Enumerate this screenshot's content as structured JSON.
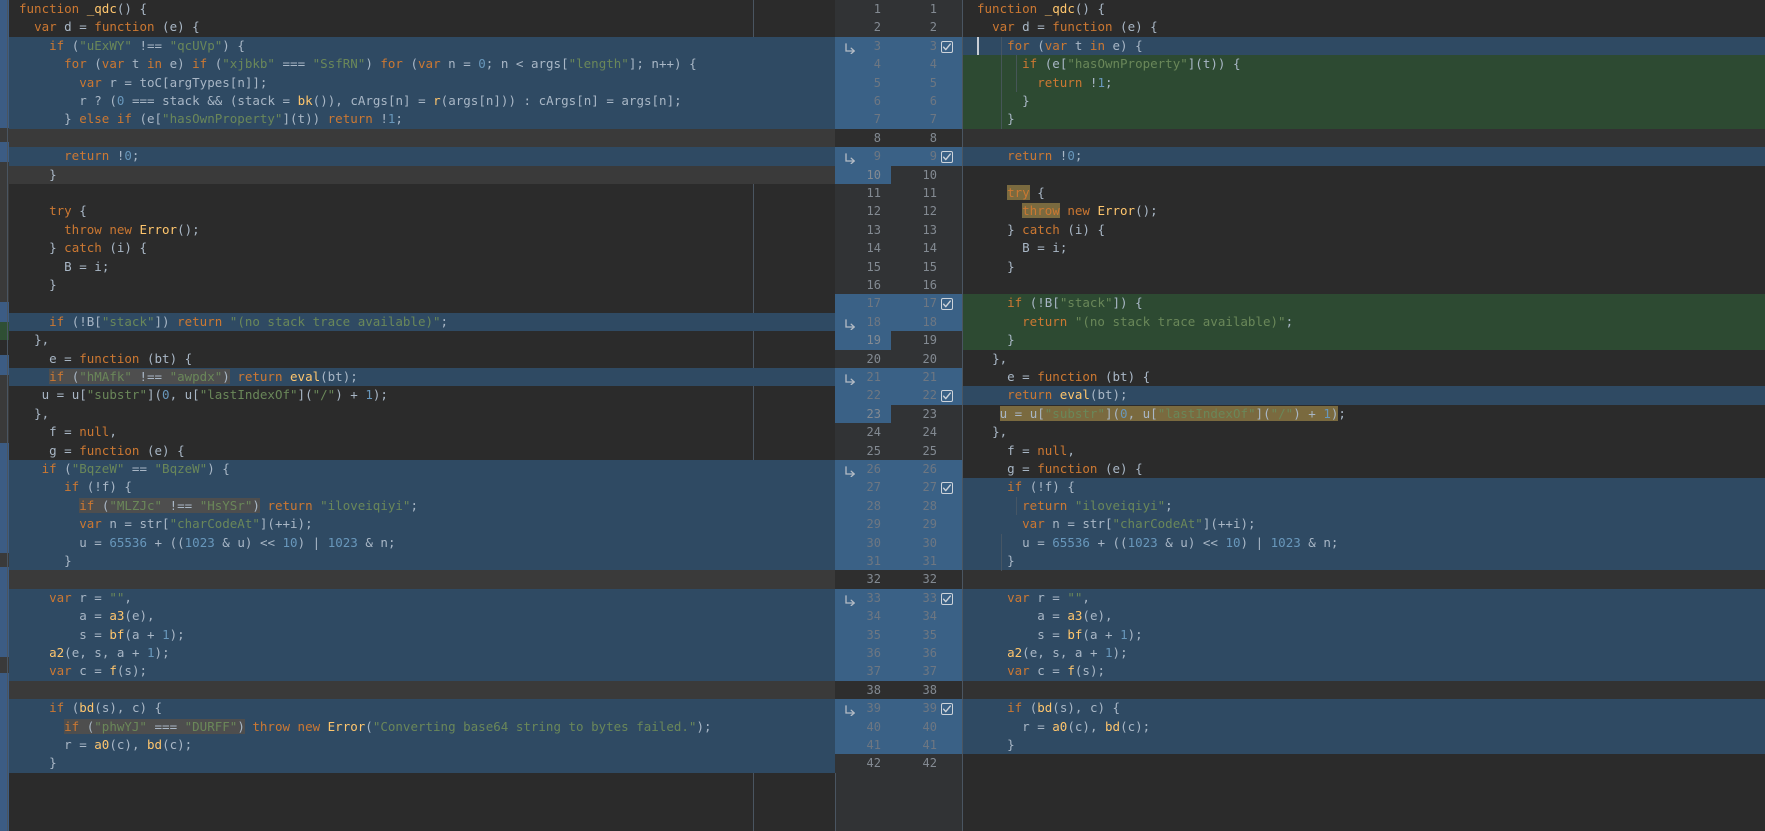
{
  "app": {
    "type": "ide-diff-viewer",
    "theme": "darcula",
    "colors": {
      "background": "#2b2b2b",
      "gutter": "#313335",
      "modified_row": "#2f4a63",
      "added_row": "#2d4a32",
      "unchanged_gap": "#3a3a3a",
      "gutter_selected": "#3a6186",
      "inline_match_highlight": "#7a6a3f",
      "keyword": "#cc7832",
      "string": "#6a8759",
      "number": "#6897bb",
      "function": "#ffc66d",
      "identifier": "#a9b7c6",
      "class": "#b9a0d8",
      "separator": "#4a5561"
    }
  },
  "left_pane": {
    "name": "original-version",
    "lines": [
      {
        "bg": "none",
        "text": "function _qdc() {"
      },
      {
        "bg": "none",
        "text": "  var d = function (e) {"
      },
      {
        "bg": "blue",
        "text": "    if (\"uExWY\" !== \"qcUVp\") {"
      },
      {
        "bg": "blue",
        "text": "      for (var t in e) if (\"xjbkb\" === \"SsfRN\") for (var n = 0; n < args[\"length\"]; n++) {"
      },
      {
        "bg": "blue",
        "text": "        var r = toC[argTypes[n]];"
      },
      {
        "bg": "blue",
        "text": "        r ? (0 === stack && (stack = bk()), cArgs[n] = r(args[n])) : cArgs[n] = args[n];"
      },
      {
        "bg": "blue",
        "text": "      } else if (e[\"hasOwnProperty\"](t)) return !1;"
      },
      {
        "bg": "gray",
        "text": ""
      },
      {
        "bg": "blue",
        "text": "      return !0;"
      },
      {
        "bg": "gray",
        "text": "    }"
      },
      {
        "bg": "none",
        "text": ""
      },
      {
        "bg": "none",
        "text": "    try {"
      },
      {
        "bg": "none",
        "text": "      throw new Error();"
      },
      {
        "bg": "none",
        "text": "    } catch (i) {"
      },
      {
        "bg": "none",
        "text": "      B = i;"
      },
      {
        "bg": "none",
        "text": "    }"
      },
      {
        "bg": "none",
        "text": ""
      },
      {
        "bg": "blue",
        "text": "    if (!B[\"stack\"]) return \"(no stack trace available)\";"
      },
      {
        "bg": "none",
        "text": "  },"
      },
      {
        "bg": "none",
        "text": "    e = function (bt) {"
      },
      {
        "bg": "blue",
        "text": "    if (\"hMAfk\" !== \"awpdx\") return eval(bt);"
      },
      {
        "bg": "none",
        "text": "   u = u[\"substr\"](0, u[\"lastIndexOf\"](\"/\") + 1);"
      },
      {
        "bg": "none",
        "text": "  },"
      },
      {
        "bg": "none",
        "text": "    f = null,"
      },
      {
        "bg": "none",
        "text": "    g = function (e) {"
      },
      {
        "bg": "blue",
        "text": "   if (\"BqzeW\" == \"BqzeW\") {"
      },
      {
        "bg": "blue",
        "text": "      if (!f) {"
      },
      {
        "bg": "blue",
        "text": "        if (\"MLZJc\" !== \"HsYSr\") return \"iloveiqiyi\";"
      },
      {
        "bg": "blue",
        "text": "        var n = str[\"charCodeAt\"](++i);"
      },
      {
        "bg": "blue",
        "text": "        u = 65536 + ((1023 & u) << 10) | 1023 & n;"
      },
      {
        "bg": "blue",
        "text": "      }"
      },
      {
        "bg": "gray",
        "text": ""
      },
      {
        "bg": "blue",
        "text": "    var r = \"\","
      },
      {
        "bg": "blue",
        "text": "        a = a3(e),"
      },
      {
        "bg": "blue",
        "text": "        s = bf(a + 1);"
      },
      {
        "bg": "blue",
        "text": "    a2(e, s, a + 1);"
      },
      {
        "bg": "blue",
        "text": "    var c = f(s);"
      },
      {
        "bg": "gray",
        "text": ""
      },
      {
        "bg": "blue",
        "text": "    if (bd(s), c) {"
      },
      {
        "bg": "blue",
        "text": "      if (\"phwYJ\" === \"DURFF\") throw new Error(\"Converting base64 string to bytes failed.\");"
      },
      {
        "bg": "blue",
        "text": "      r = a0(c), bd(c);"
      },
      {
        "bg": "blue",
        "text": "    }"
      }
    ]
  },
  "gutter": {
    "name": "diff-gutter",
    "rows": [
      {
        "left": "1",
        "right": "1",
        "bg": "dark",
        "check": false,
        "arrow": false
      },
      {
        "left": "2",
        "right": "2",
        "bg": "dark",
        "check": false,
        "arrow": false
      },
      {
        "left": "3",
        "right": "3",
        "bg": "blue",
        "check": true,
        "arrow": true
      },
      {
        "left": "4",
        "right": "4",
        "bg": "blue",
        "check": false,
        "arrow": false
      },
      {
        "left": "5",
        "right": "5",
        "bg": "blue",
        "check": false,
        "arrow": false
      },
      {
        "left": "6",
        "right": "6",
        "bg": "blue",
        "check": false,
        "arrow": false
      },
      {
        "left": "7",
        "right": "7",
        "bg": "blue",
        "check": false,
        "arrow": false
      },
      {
        "left": "8",
        "right": "8",
        "bg": "darker",
        "check": false,
        "arrow": false
      },
      {
        "left": "9",
        "right": "9",
        "bg": "blue",
        "check": true,
        "arrow": true
      },
      {
        "left": "10",
        "right": "10",
        "bg": "split",
        "check": false,
        "arrow": false
      },
      {
        "left": "11",
        "right": "11",
        "bg": "dark",
        "check": false,
        "arrow": false
      },
      {
        "left": "12",
        "right": "12",
        "bg": "dark",
        "check": false,
        "arrow": false
      },
      {
        "left": "13",
        "right": "13",
        "bg": "dark",
        "check": false,
        "arrow": false
      },
      {
        "left": "14",
        "right": "14",
        "bg": "dark",
        "check": false,
        "arrow": false
      },
      {
        "left": "15",
        "right": "15",
        "bg": "dark",
        "check": false,
        "arrow": false
      },
      {
        "left": "16",
        "right": "16",
        "bg": "dark",
        "check": false,
        "arrow": false
      },
      {
        "left": "17",
        "right": "17",
        "bg": "blue",
        "check": true,
        "arrow": false
      },
      {
        "left": "18",
        "right": "18",
        "bg": "blue",
        "check": false,
        "arrow": true
      },
      {
        "left": "19",
        "right": "19",
        "bg": "split",
        "check": false,
        "arrow": false
      },
      {
        "left": "20",
        "right": "20",
        "bg": "dark",
        "check": false,
        "arrow": false
      },
      {
        "left": "21",
        "right": "21",
        "bg": "blue",
        "check": false,
        "arrow": true
      },
      {
        "left": "22",
        "right": "22",
        "bg": "blue",
        "check": true,
        "arrow": false
      },
      {
        "left": "23",
        "right": "23",
        "bg": "split",
        "check": false,
        "arrow": false
      },
      {
        "left": "24",
        "right": "24",
        "bg": "dark",
        "check": false,
        "arrow": false
      },
      {
        "left": "25",
        "right": "25",
        "bg": "dark",
        "check": false,
        "arrow": false
      },
      {
        "left": "26",
        "right": "26",
        "bg": "blue",
        "check": false,
        "arrow": true
      },
      {
        "left": "27",
        "right": "27",
        "bg": "blue",
        "check": true,
        "arrow": false
      },
      {
        "left": "28",
        "right": "28",
        "bg": "blue",
        "check": false,
        "arrow": false
      },
      {
        "left": "29",
        "right": "29",
        "bg": "blue",
        "check": false,
        "arrow": false
      },
      {
        "left": "30",
        "right": "30",
        "bg": "blue",
        "check": false,
        "arrow": false
      },
      {
        "left": "31",
        "right": "31",
        "bg": "blue",
        "check": false,
        "arrow": false
      },
      {
        "left": "32",
        "right": "32",
        "bg": "darker",
        "check": false,
        "arrow": false
      },
      {
        "left": "33",
        "right": "33",
        "bg": "blue",
        "check": true,
        "arrow": true
      },
      {
        "left": "34",
        "right": "34",
        "bg": "blue",
        "check": false,
        "arrow": false
      },
      {
        "left": "35",
        "right": "35",
        "bg": "blue",
        "check": false,
        "arrow": false
      },
      {
        "left": "36",
        "right": "36",
        "bg": "blue",
        "check": false,
        "arrow": false
      },
      {
        "left": "37",
        "right": "37",
        "bg": "blue",
        "check": false,
        "arrow": false
      },
      {
        "left": "38",
        "right": "38",
        "bg": "darker",
        "check": false,
        "arrow": false
      },
      {
        "left": "39",
        "right": "39",
        "bg": "blue",
        "check": true,
        "arrow": true
      },
      {
        "left": "40",
        "right": "40",
        "bg": "blue",
        "check": false,
        "arrow": false
      },
      {
        "left": "41",
        "right": "41",
        "bg": "blue",
        "check": false,
        "arrow": false
      },
      {
        "left": "42",
        "right": "42",
        "bg": "dark",
        "check": false,
        "arrow": false
      }
    ],
    "checkbox_glyph": "☑",
    "arrow_glyph": "⌐"
  },
  "right_pane": {
    "name": "modified-version",
    "lines": [
      {
        "bg": "none",
        "text": "function _qdc() {"
      },
      {
        "bg": "none",
        "text": "  var d = function (e) {"
      },
      {
        "bg": "blue",
        "text": "    for (var t in e) {"
      },
      {
        "bg": "green",
        "text": "      if (e[\"hasOwnProperty\"](t)) {"
      },
      {
        "bg": "green",
        "text": "        return !1;"
      },
      {
        "bg": "green",
        "text": "      }"
      },
      {
        "bg": "green",
        "text": "    }"
      },
      {
        "bg": "dark",
        "text": ""
      },
      {
        "bg": "blue",
        "text": "    return !0;"
      },
      {
        "bg": "none",
        "text": ""
      },
      {
        "bg": "none",
        "text": "    try {"
      },
      {
        "bg": "none",
        "text": "      throw new Error();"
      },
      {
        "bg": "none",
        "text": "    } catch (i) {"
      },
      {
        "bg": "none",
        "text": "      B = i;"
      },
      {
        "bg": "none",
        "text": "    }"
      },
      {
        "bg": "none",
        "text": ""
      },
      {
        "bg": "green",
        "text": "    if (!B[\"stack\"]) {"
      },
      {
        "bg": "green",
        "text": "      return \"(no stack trace available)\";"
      },
      {
        "bg": "green",
        "text": "    }"
      },
      {
        "bg": "none",
        "text": "  },"
      },
      {
        "bg": "none",
        "text": "    e = function (bt) {"
      },
      {
        "bg": "blue",
        "text": "    return eval(bt);"
      },
      {
        "bg": "none",
        "text": "   u = u[\"substr\"](0, u[\"lastIndexOf\"](\"/\") + 1);"
      },
      {
        "bg": "none",
        "text": "  },"
      },
      {
        "bg": "none",
        "text": "    f = null,"
      },
      {
        "bg": "none",
        "text": "    g = function (e) {"
      },
      {
        "bg": "blue",
        "text": "    if (!f) {"
      },
      {
        "bg": "blue",
        "text": "      return \"iloveiqiyi\";"
      },
      {
        "bg": "blue",
        "text": "      var n = str[\"charCodeAt\"](++i);"
      },
      {
        "bg": "blue",
        "text": "      u = 65536 + ((1023 & u) << 10) | 1023 & n;"
      },
      {
        "bg": "blue",
        "text": "    }"
      },
      {
        "bg": "dark",
        "text": ""
      },
      {
        "bg": "blue",
        "text": "    var r = \"\","
      },
      {
        "bg": "blue",
        "text": "        a = a3(e),"
      },
      {
        "bg": "blue",
        "text": "        s = bf(a + 1);"
      },
      {
        "bg": "blue",
        "text": "    a2(e, s, a + 1);"
      },
      {
        "bg": "blue",
        "text": "    var c = f(s);"
      },
      {
        "bg": "dark",
        "text": ""
      },
      {
        "bg": "blue",
        "text": "    if (bd(s), c) {"
      },
      {
        "bg": "blue",
        "text": "      r = a0(c), bd(c);"
      },
      {
        "bg": "blue",
        "text": "    }"
      }
    ]
  }
}
